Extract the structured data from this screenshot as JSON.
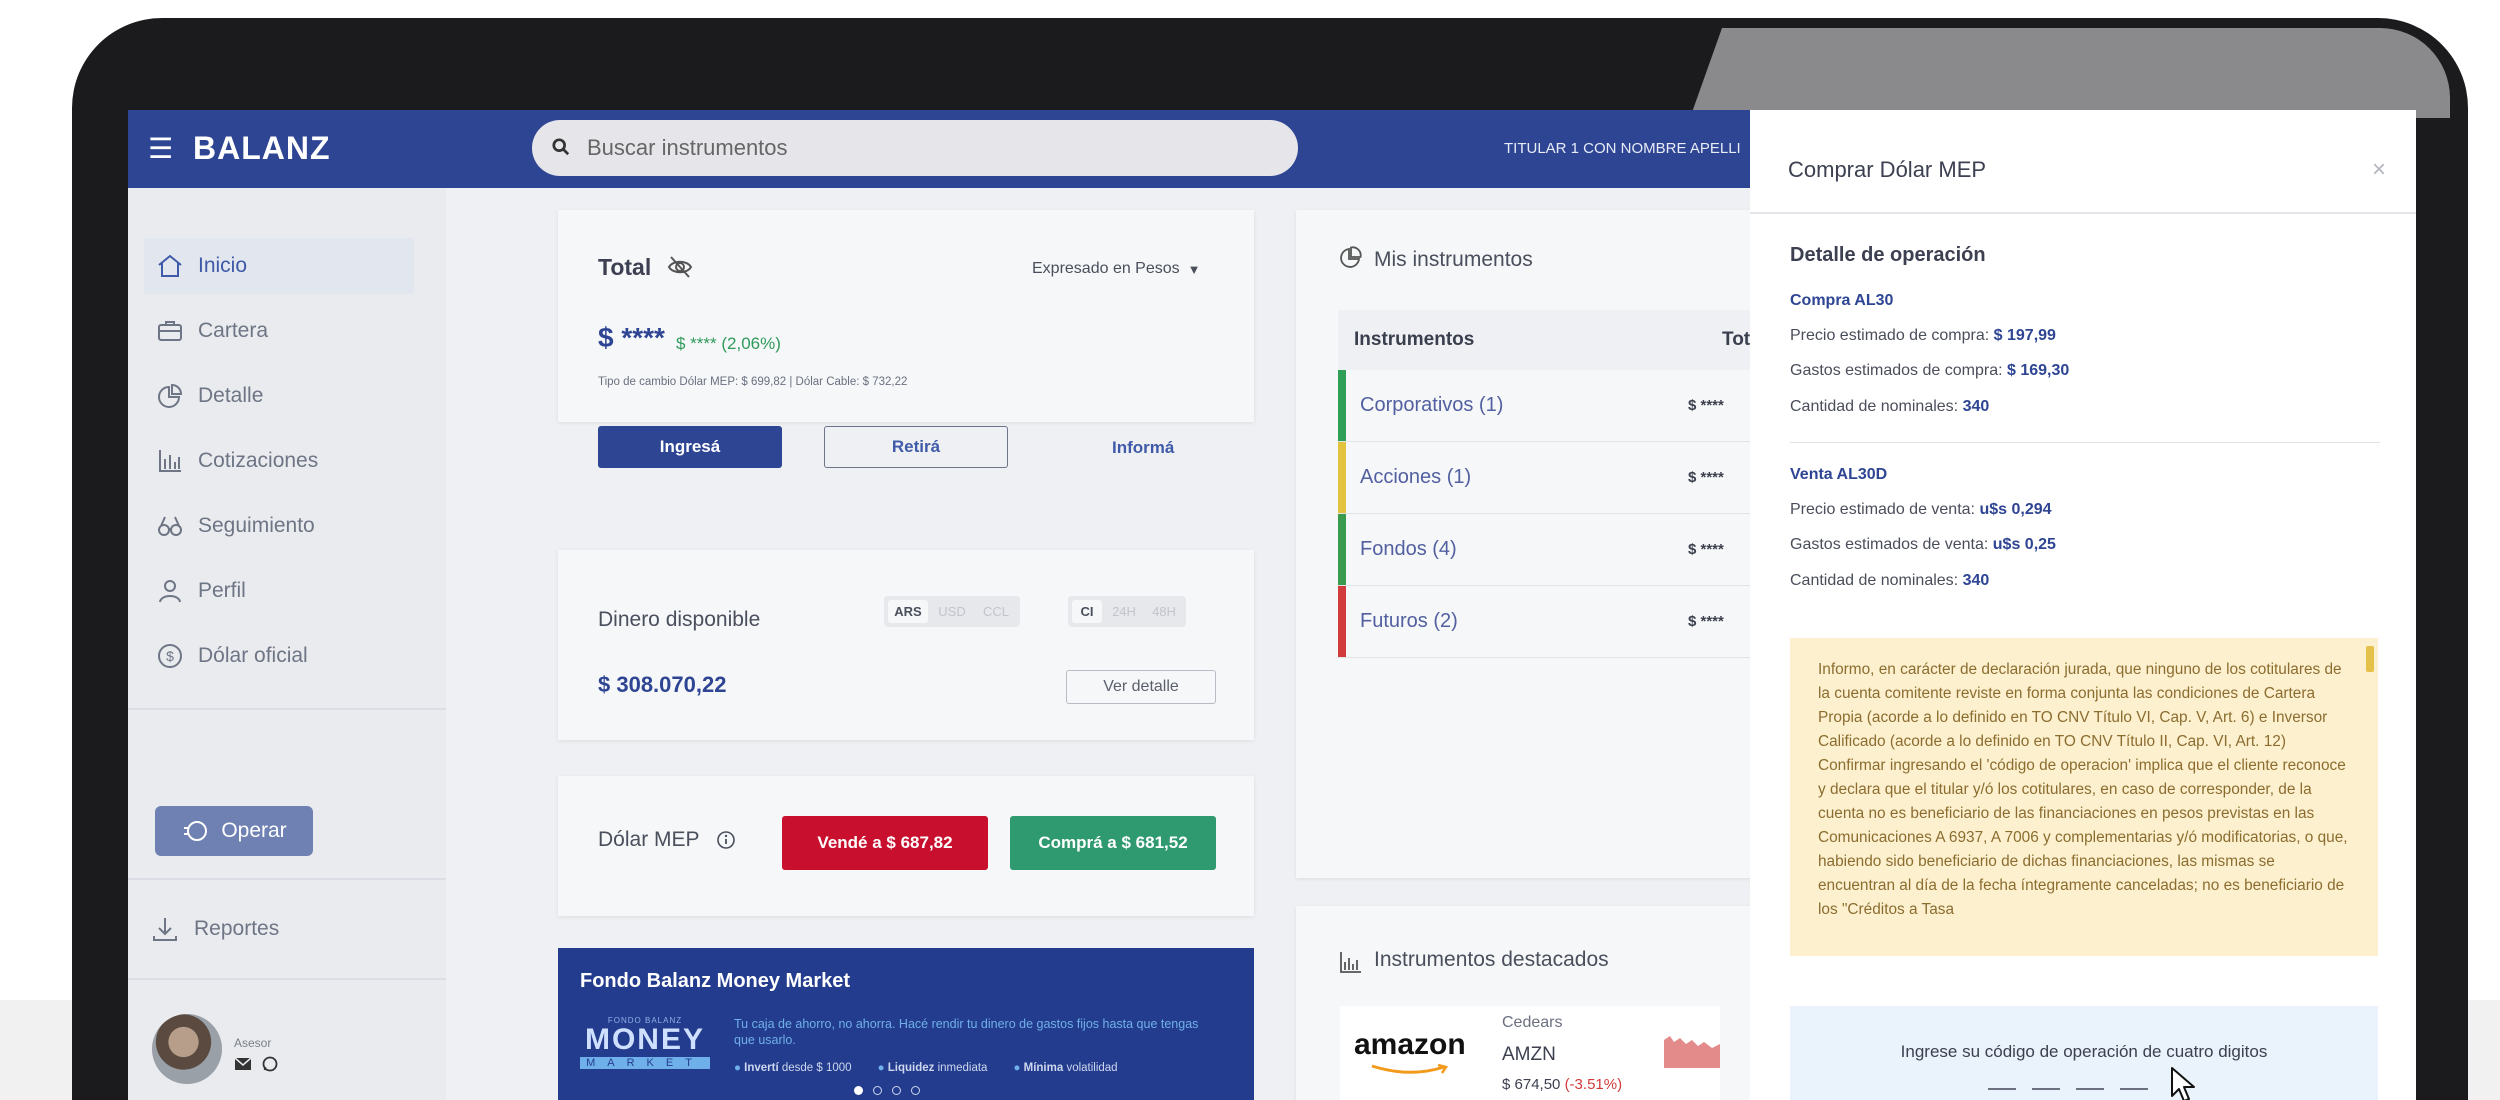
{
  "app": {
    "logo": "BALANZ",
    "user": "TITULAR 1 CON NOMBRE APELLI"
  },
  "search": {
    "placeholder": "Buscar instrumentos"
  },
  "sidebar": {
    "items": [
      {
        "label": "Inicio",
        "icon": "home-icon"
      },
      {
        "label": "Cartera",
        "icon": "briefcase-icon"
      },
      {
        "label": "Detalle",
        "icon": "pie-chart-icon"
      },
      {
        "label": "Cotizaciones",
        "icon": "bar-chart-icon"
      },
      {
        "label": "Seguimiento",
        "icon": "binoculars-icon"
      },
      {
        "label": "Perfil",
        "icon": "user-icon"
      },
      {
        "label": "Dólar oficial",
        "icon": "dollar-icon"
      }
    ],
    "operar": "Operar",
    "reportes": "Reportes",
    "asesor": "Asesor"
  },
  "total_card": {
    "title": "Total",
    "expresado": "Expresado en Pesos",
    "amount": "$ ****",
    "change": "$ **** (2,06%)",
    "exchange": "Tipo de cambio Dólar MEP: $ 699,82 | Dólar Cable: $ 732,22",
    "ingresa": "Ingresá",
    "retira": "Retirá",
    "informa": "Informá"
  },
  "dinero_card": {
    "title": "Dinero disponible",
    "currencies": [
      "ARS",
      "USD",
      "CCL"
    ],
    "terms": [
      "CI",
      "24H",
      "48H"
    ],
    "amount": "$ 308.070,22",
    "detalle": "Ver detalle"
  },
  "mep_card": {
    "title": "Dólar MEP",
    "vende": "Vendé a $ 687,82",
    "compra": "Comprá a $ 681,52"
  },
  "money_market": {
    "title": "Fondo Balanz Money Market",
    "brand_small": "FONDO BALANZ",
    "brand": "MONEY",
    "brand_sub": "MARKET",
    "tagline": "Tu caja de ahorro, no ahorra. Hacé rendir tu dinero de gastos fijos hasta que tengas que usarlo.",
    "b1a": "Invertí",
    "b1b": "desde $ 1000",
    "b2a": "Liquidez",
    "b2b": "inmediata",
    "b3a": "Mínima",
    "b3b": "volatilidad"
  },
  "instruments": {
    "title": "Mis instrumentos",
    "col_instr": "Instrumentos",
    "col_total": "Total",
    "rows": [
      {
        "label": "Corporativos (1)",
        "amount": "$ ****",
        "color": "#2f9e57"
      },
      {
        "label": "Acciones (1)",
        "amount": "$ ****",
        "color": "#e3c23d"
      },
      {
        "label": "Fondos (4)",
        "amount": "$ ****",
        "color": "#3a9a4e"
      },
      {
        "label": "Futuros (2)",
        "amount": "$ ****",
        "color": "#d13b3b"
      }
    ]
  },
  "destacados": {
    "title": "Instrumentos destacados",
    "brand": "amazon",
    "category": "Cedears",
    "ticker": "AMZN",
    "price": "$ 674,50",
    "change": "(-3.51%)"
  },
  "modal": {
    "title": "Comprar Dólar MEP",
    "close": "×",
    "detail_title": "Detalle de operación",
    "compra_title": "Compra AL30",
    "compra_precio_label": "Precio estimado de compra:",
    "compra_precio": "$ 197,99",
    "compra_gastos_label": "Gastos estimados de compra:",
    "compra_gastos": "$ 169,30",
    "compra_cant_label": "Cantidad de nominales:",
    "compra_cant": "340",
    "venta_title": "Venta AL30D",
    "venta_precio_label": "Precio estimado de venta:",
    "venta_precio": "u$s 0,294",
    "venta_gastos_label": "Gastos estimados de venta:",
    "venta_gastos": "u$s 0,25",
    "venta_cant_label": "Cantidad de nominales:",
    "venta_cant": "340",
    "declaration": "Informo, en carácter de declaración jurada, que ninguno de los cotitulares de la cuenta comitente reviste en forma conjunta las condiciones de Cartera Propia (acorde a lo definido en TO CNV Título VI, Cap. V, Art. 6) e Inversor Calificado (acorde a lo definido en TO CNV Título II, Cap. VI, Art. 12) Confirmar ingresando el 'código de operacion' implica que el cliente reconoce y declara que el titular y/ó los cotitulares, en caso de corresponder, de la cuenta no es beneficiario de las financiaciones en pesos previstas en las Comunicaciones A 6937, A 7006 y complementarias y/ó modificatorias, o que, habiendo sido beneficiario de dichas financiaciones, las mismas se encuentran al día de la fecha íntegramente canceladas; no es beneficiario de los \"Créditos a Tasa",
    "code_label": "Ingrese su código de operación de cuatro digitos"
  }
}
